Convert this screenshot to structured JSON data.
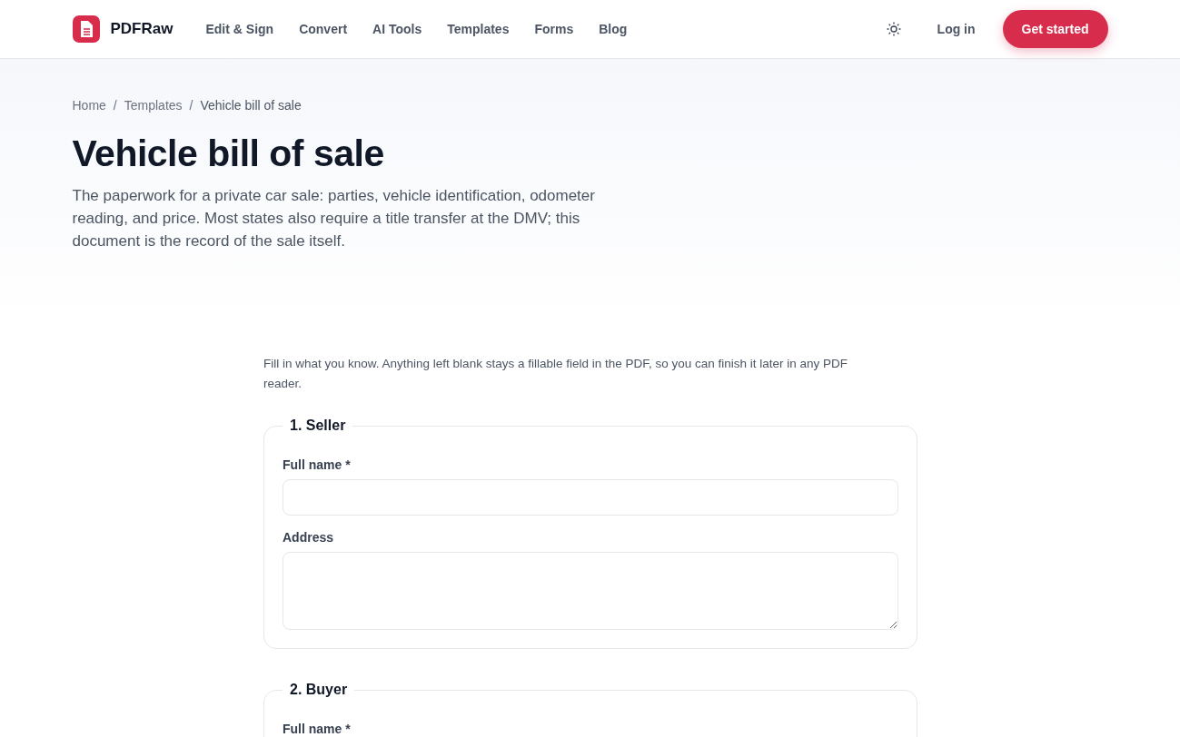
{
  "header": {
    "brand": "PDFRaw",
    "nav": [
      {
        "label": "Edit & Sign"
      },
      {
        "label": "Convert"
      },
      {
        "label": "AI Tools"
      },
      {
        "label": "Templates"
      },
      {
        "label": "Forms"
      },
      {
        "label": "Blog"
      }
    ],
    "login": "Log in",
    "cta": "Get started"
  },
  "breadcrumb": [
    {
      "label": "Home",
      "kind": "link"
    },
    {
      "label": "Templates",
      "kind": "link"
    },
    {
      "label": "Vehicle bill of sale",
      "kind": "current"
    }
  ],
  "breadcrumb_separator": "/",
  "title": "Vehicle bill of sale",
  "description": "The paperwork for a private car sale: parties, vehicle identification, odometer reading, and price. Most states also require a title transfer at the DMV; this document is the record of the sale itself.",
  "form": {
    "intro": "Fill in what you know. Anything left blank stays a fillable field in the PDF, so you can finish it later in any PDF reader.",
    "sections": [
      {
        "legend": "1. Seller",
        "fields": [
          {
            "label": "Full name *",
            "kind": "text"
          },
          {
            "label": "Address",
            "kind": "textarea"
          }
        ]
      },
      {
        "legend": "2. Buyer",
        "fields": [
          {
            "label": "Full name *",
            "kind": "label"
          }
        ]
      }
    ]
  }
}
